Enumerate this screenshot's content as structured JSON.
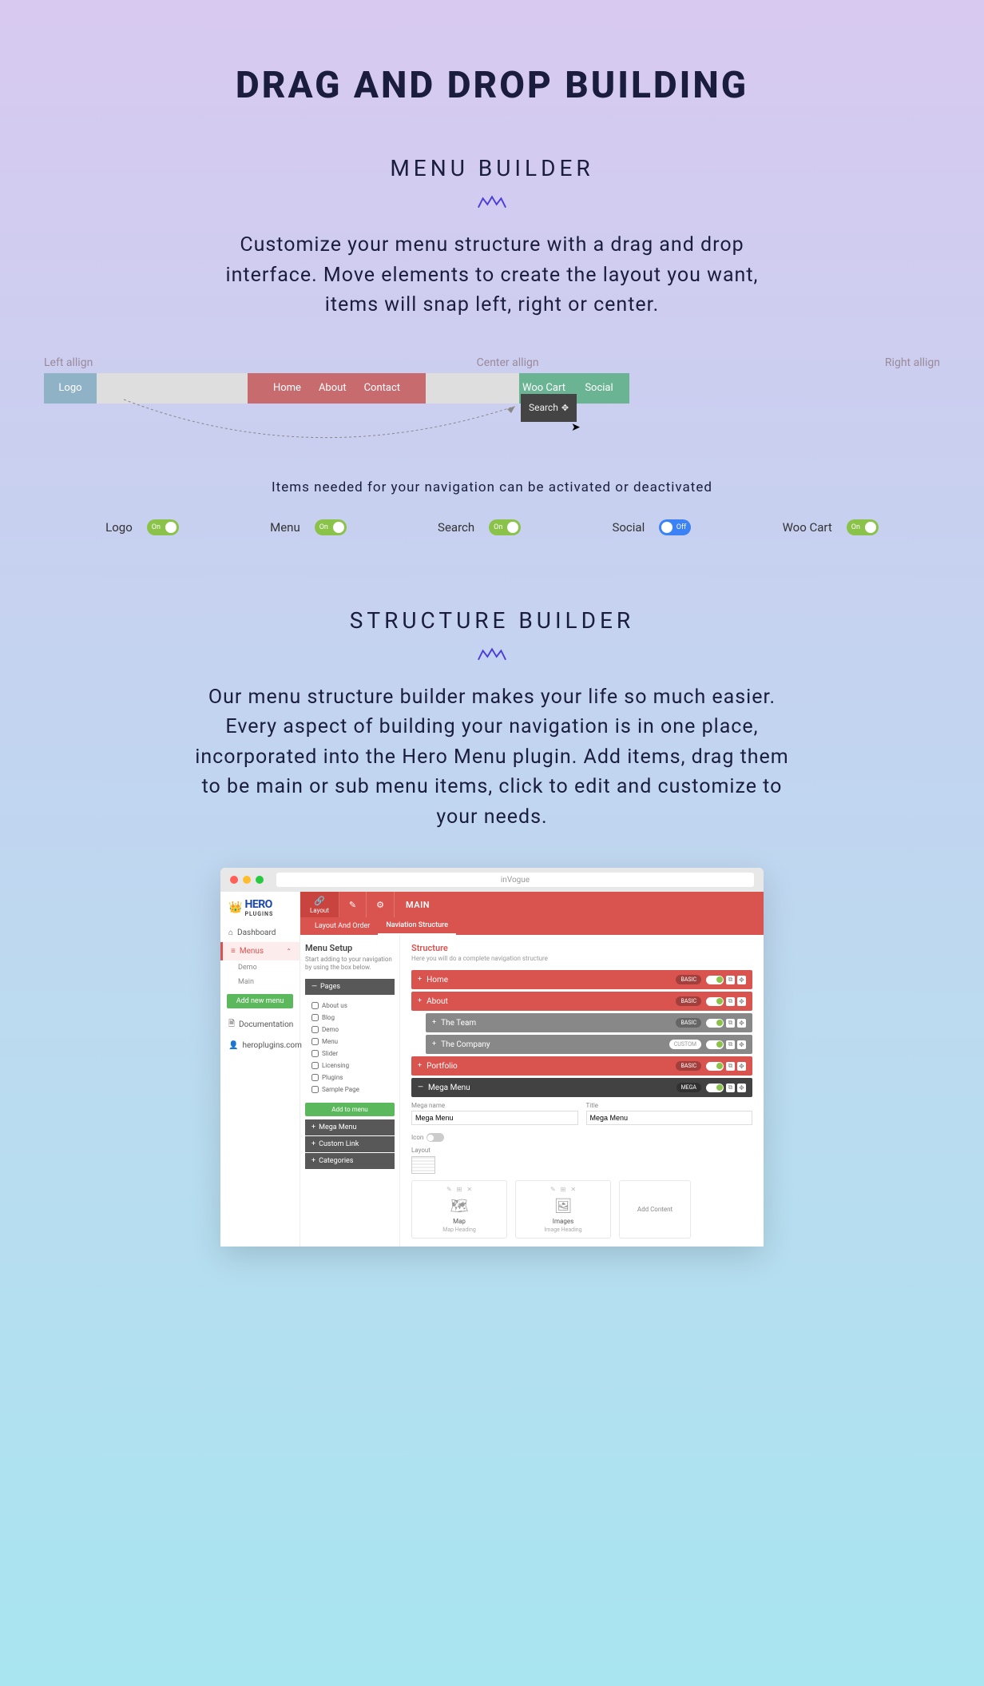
{
  "main_title": "DRAG AND DROP BUILDING",
  "section1": {
    "title": "MENU BUILDER",
    "desc": "Customize your menu structure with a drag and drop interface. Move elements to create the layout you want, items will snap left, right or center.",
    "labels": {
      "left": "Left allign",
      "center": "Center allign",
      "right": "Right allign"
    },
    "items": {
      "logo": "Logo",
      "home": "Home",
      "about": "About",
      "contact": "Contact",
      "search": "Search",
      "woo": "Woo Cart",
      "social": "Social"
    },
    "note": "Items needed for your navigation can be activated or deactivated",
    "toggles": [
      {
        "label": "Logo",
        "state": "On"
      },
      {
        "label": "Menu",
        "state": "On"
      },
      {
        "label": "Search",
        "state": "On"
      },
      {
        "label": "Social",
        "state": "Off"
      },
      {
        "label": "Woo Cart",
        "state": "On"
      }
    ]
  },
  "section2": {
    "title": "STRUCTURE BUILDER",
    "desc": "Our menu structure builder makes your life so much easier. Every aspect of building your navigation is in one place, incorporated into the Hero Menu plugin. Add items, drag them to be main or sub menu items, click to edit and customize to your needs."
  },
  "screenshot": {
    "url": "inVogue",
    "logo": {
      "brand": "HERO",
      "sub": "PLUGINS"
    },
    "sidebar": {
      "items": [
        "Dashboard",
        "Menus",
        "Demo",
        "Main",
        "Documentation",
        "heroplugins.com"
      ],
      "add_btn": "Add new menu"
    },
    "top_tabs": {
      "layout": "Layout",
      "main": "MAIN"
    },
    "sub_tabs": [
      "Layout And Order",
      "Naviation Structure"
    ],
    "left_panel": {
      "title": "Menu Setup",
      "sub": "Start adding to your navigation by using the box below.",
      "accordion": [
        "Pages",
        "Mega Menu",
        "Custom Link",
        "Categories"
      ],
      "pages": [
        "About us",
        "Blog",
        "Demo",
        "Menu",
        "Slider",
        "Licensing",
        "Plugins",
        "Sample Page"
      ],
      "add_btn": "Add to menu"
    },
    "structure": {
      "title": "Structure",
      "sub": "Here you will do a complete navigation structure",
      "items": [
        {
          "label": "Home",
          "badge": "BASIC",
          "type": "red"
        },
        {
          "label": "About",
          "badge": "BASIC",
          "type": "red"
        },
        {
          "label": "The Team",
          "badge": "BASIC",
          "type": "gray",
          "indent": true
        },
        {
          "label": "The Company",
          "badge": "CUSTOM",
          "type": "gray",
          "indent": true
        },
        {
          "label": "Portfolio",
          "badge": "BASIC",
          "type": "red"
        },
        {
          "label": "Mega Menu",
          "badge": "MEGA",
          "type": "dark"
        }
      ],
      "form": {
        "name_label": "Mega name",
        "name_val": "Mega Menu",
        "title_label": "Title",
        "title_val": "Mega Menu",
        "icon_label": "Icon",
        "layout_label": "Layout"
      },
      "cards": [
        {
          "name": "Map",
          "heading": "Map Heading"
        },
        {
          "name": "Images",
          "heading": "Image Heading"
        }
      ],
      "add_content": "Add Content"
    }
  }
}
